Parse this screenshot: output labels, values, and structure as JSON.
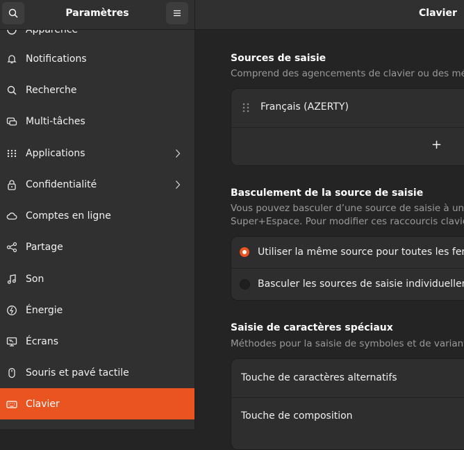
{
  "sidebar": {
    "title": "Paramètres",
    "items": [
      {
        "label": "Apparence",
        "icon": "appearance-icon"
      },
      {
        "label": "Notifications",
        "icon": "bell-icon"
      },
      {
        "label": "Recherche",
        "icon": "search-icon"
      },
      {
        "label": "Multi-tâches",
        "icon": "multitasking-icon"
      },
      {
        "label": "Applications",
        "icon": "apps-grid-icon",
        "chevron": true
      },
      {
        "label": "Confidentialité",
        "icon": "lock-icon",
        "chevron": true
      },
      {
        "label": "Comptes en ligne",
        "icon": "cloud-icon"
      },
      {
        "label": "Partage",
        "icon": "share-icon"
      },
      {
        "label": "Son",
        "icon": "music-note-icon"
      },
      {
        "label": "Énergie",
        "icon": "power-icon"
      },
      {
        "label": "Écrans",
        "icon": "display-icon"
      },
      {
        "label": "Souris et pavé tactile",
        "icon": "mouse-icon"
      },
      {
        "label": "Clavier",
        "icon": "keyboard-icon",
        "active": true
      }
    ]
  },
  "header": {
    "title": "Clavier"
  },
  "input_sources": {
    "title": "Sources de saisie",
    "description": "Comprend des agencements de clavier ou des méth",
    "items": [
      "Français (AZERTY)"
    ],
    "add_label": "+"
  },
  "switching": {
    "title": "Basculement de la source de saisie",
    "description_line1": "Vous pouvez basculer d’une source de saisie à une a",
    "description_line2": "Super+Espace. Pour modifier ces raccourcis clavier",
    "options": [
      {
        "label": "Utiliser la même source pour toutes les fenêt",
        "selected": true
      },
      {
        "label": "Basculer les sources de saisie individuelleme",
        "selected": false
      }
    ]
  },
  "special_chars": {
    "title": "Saisie de caractères spéciaux",
    "description": "Méthodes pour la saisie de symboles et de variante",
    "items": [
      "Touche de caractères alternatifs",
      "Touche de composition"
    ]
  },
  "colors": {
    "accent": "#e95420"
  }
}
